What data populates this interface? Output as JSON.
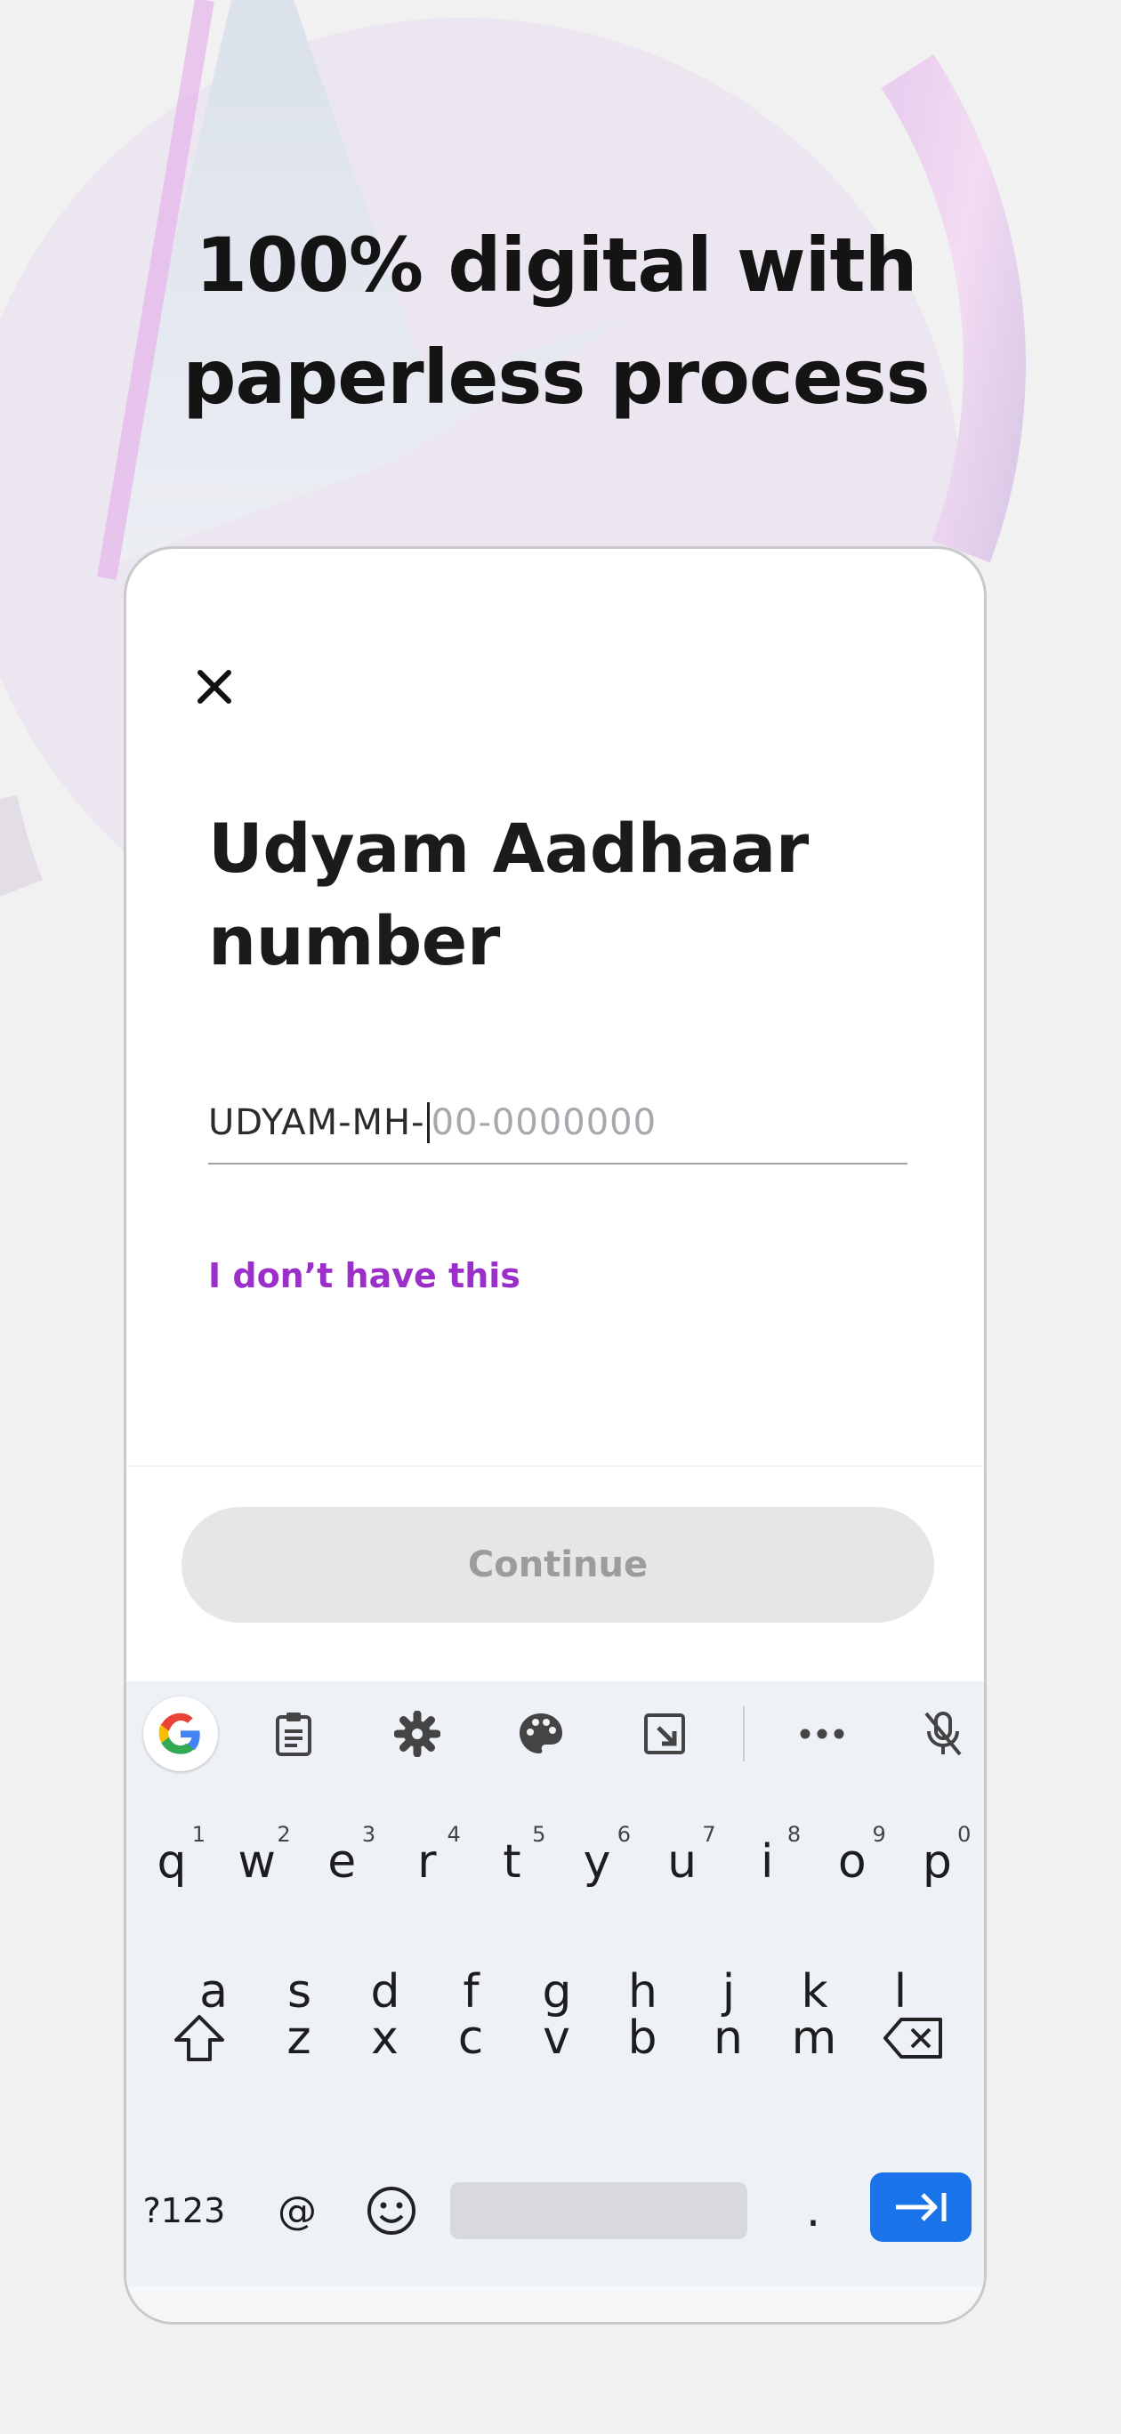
{
  "headline": {
    "line1": "100% digital with",
    "line2": "paperless process"
  },
  "form": {
    "title_line1": "Udyam Aadhaar",
    "title_line2": "number",
    "input_prefix": "UDYAM-MH-",
    "input_placeholder": "00-0000000",
    "no_number_link": "I don’t have this",
    "continue_label": "Continue"
  },
  "keyboard": {
    "toolbar_icons": [
      "google-icon",
      "clipboard-icon",
      "settings-icon",
      "palette-icon",
      "resize-icon",
      "more-icon",
      "mic-off-icon"
    ],
    "row1": [
      {
        "key": "q",
        "hint": "1"
      },
      {
        "key": "w",
        "hint": "2"
      },
      {
        "key": "e",
        "hint": "3"
      },
      {
        "key": "r",
        "hint": "4"
      },
      {
        "key": "t",
        "hint": "5"
      },
      {
        "key": "y",
        "hint": "6"
      },
      {
        "key": "u",
        "hint": "7"
      },
      {
        "key": "i",
        "hint": "8"
      },
      {
        "key": "o",
        "hint": "9"
      },
      {
        "key": "p",
        "hint": "0"
      }
    ],
    "row2": [
      "a",
      "s",
      "d",
      "f",
      "g",
      "h",
      "j",
      "k",
      "l"
    ],
    "row3": [
      "z",
      "x",
      "c",
      "v",
      "b",
      "n",
      "m"
    ],
    "symbols_label": "?123",
    "at_label": "@",
    "period_label": ".",
    "accent_color": "#1a73e8"
  },
  "colors": {
    "link": "#9a30c9",
    "button_disabled": "#e6e6e6"
  }
}
